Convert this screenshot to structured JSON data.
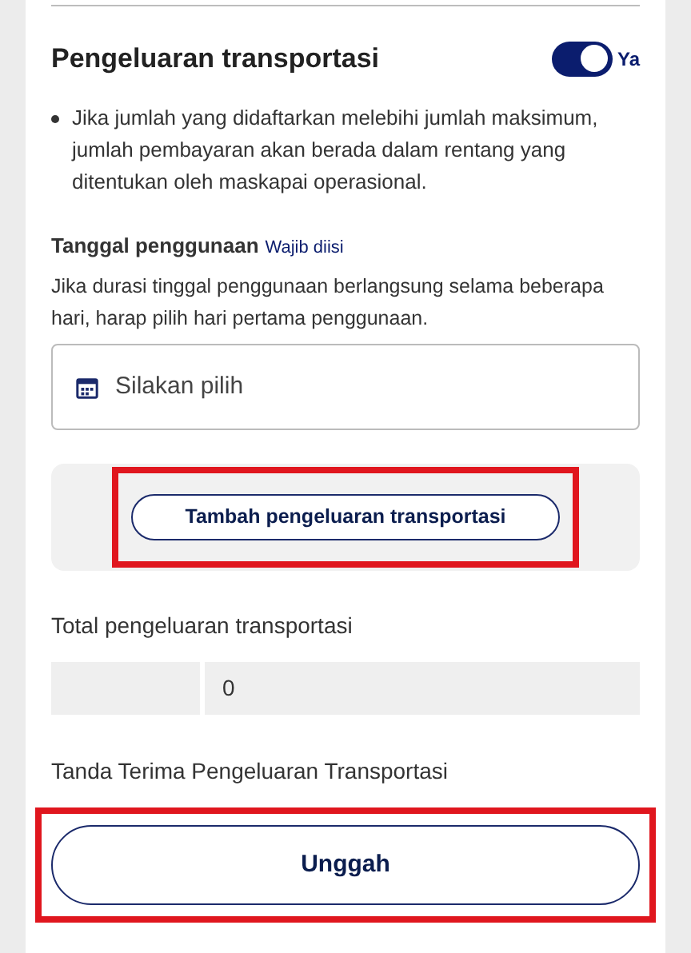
{
  "section": {
    "title": "Pengeluaran transportasi",
    "toggle": {
      "on": true,
      "label": "Ya"
    }
  },
  "notes": [
    "Jika jumlah yang didaftarkan melebihi jumlah maksimum, jumlah pembayaran akan berada dalam rentang yang ditentukan oleh maskapai operasional."
  ],
  "date_field": {
    "label": "Tanggal penggunaan",
    "required": "Wajib diisi",
    "help": "Jika durasi tinggal penggunaan berlangsung selama beberapa hari, harap pilih hari pertama penggunaan.",
    "placeholder": "Silakan pilih"
  },
  "add_button": {
    "label": "Tambah pengeluaran transportasi",
    "highlighted": true
  },
  "total": {
    "label": "Total pengeluaran transportasi",
    "value": "0"
  },
  "receipt": {
    "label": "Tanda Terima Pengeluaran Transportasi",
    "button": "Unggah",
    "highlighted": true
  }
}
